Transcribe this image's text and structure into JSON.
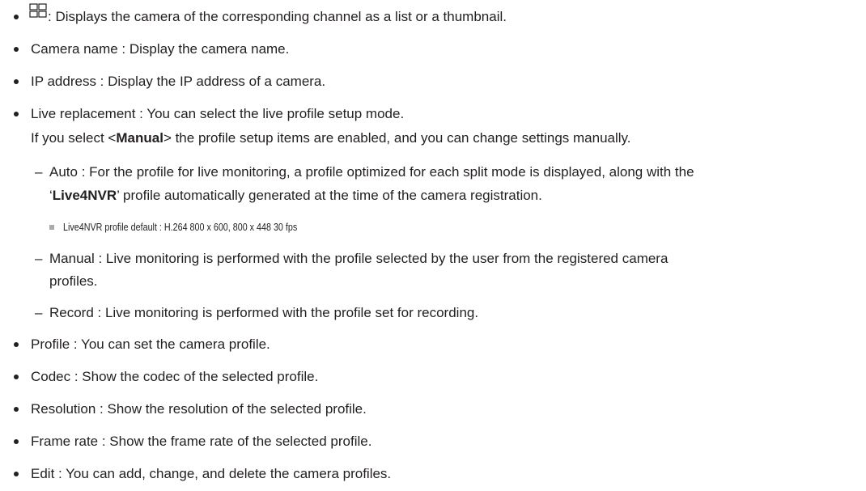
{
  "items": [
    {
      "text": ": Displays the camera of the corresponding channel as a list or a thumbnail.",
      "icon": "grid-view-icon"
    },
    {
      "text": "Camera name : Display the camera name."
    },
    {
      "text": "IP address : Display the IP address of a camera."
    },
    {
      "text": "Live replacement : You can select the live profile setup mode."
    }
  ],
  "live_replacement": {
    "line2_pre": "If you select <",
    "line2_bold": "Manual",
    "line2_post": "> the profile setup items are enabled, and you can change settings manually.",
    "auto_line1": "Auto : For the profile for live monitoring, a profile optimized for each split mode is displayed, along with the",
    "auto_line2_pre": "‘",
    "auto_line2_bold": "Live4NVR",
    "auto_line2_post": "’ profile automatically generated at the time of the camera registration.",
    "note": "Live4NVR profile default : H.264 800 x 600, 800 x 448 30 fps",
    "manual_line1": "Manual : Live monitoring is performed with the profile selected by the user from the registered camera",
    "manual_line2": "profiles.",
    "record": "Record : Live monitoring is performed with the profile set for recording.",
    "dash": "–"
  },
  "items2": [
    {
      "text": "Profile : You can set the camera profile."
    },
    {
      "text": "Codec : Show the codec of the selected profile."
    },
    {
      "text": "Resolution : Show the resolution of the selected profile."
    },
    {
      "text": "Frame rate : Show the frame rate of the selected profile."
    },
    {
      "text": "Edit : You can add, change, and delete the camera profiles."
    }
  ]
}
